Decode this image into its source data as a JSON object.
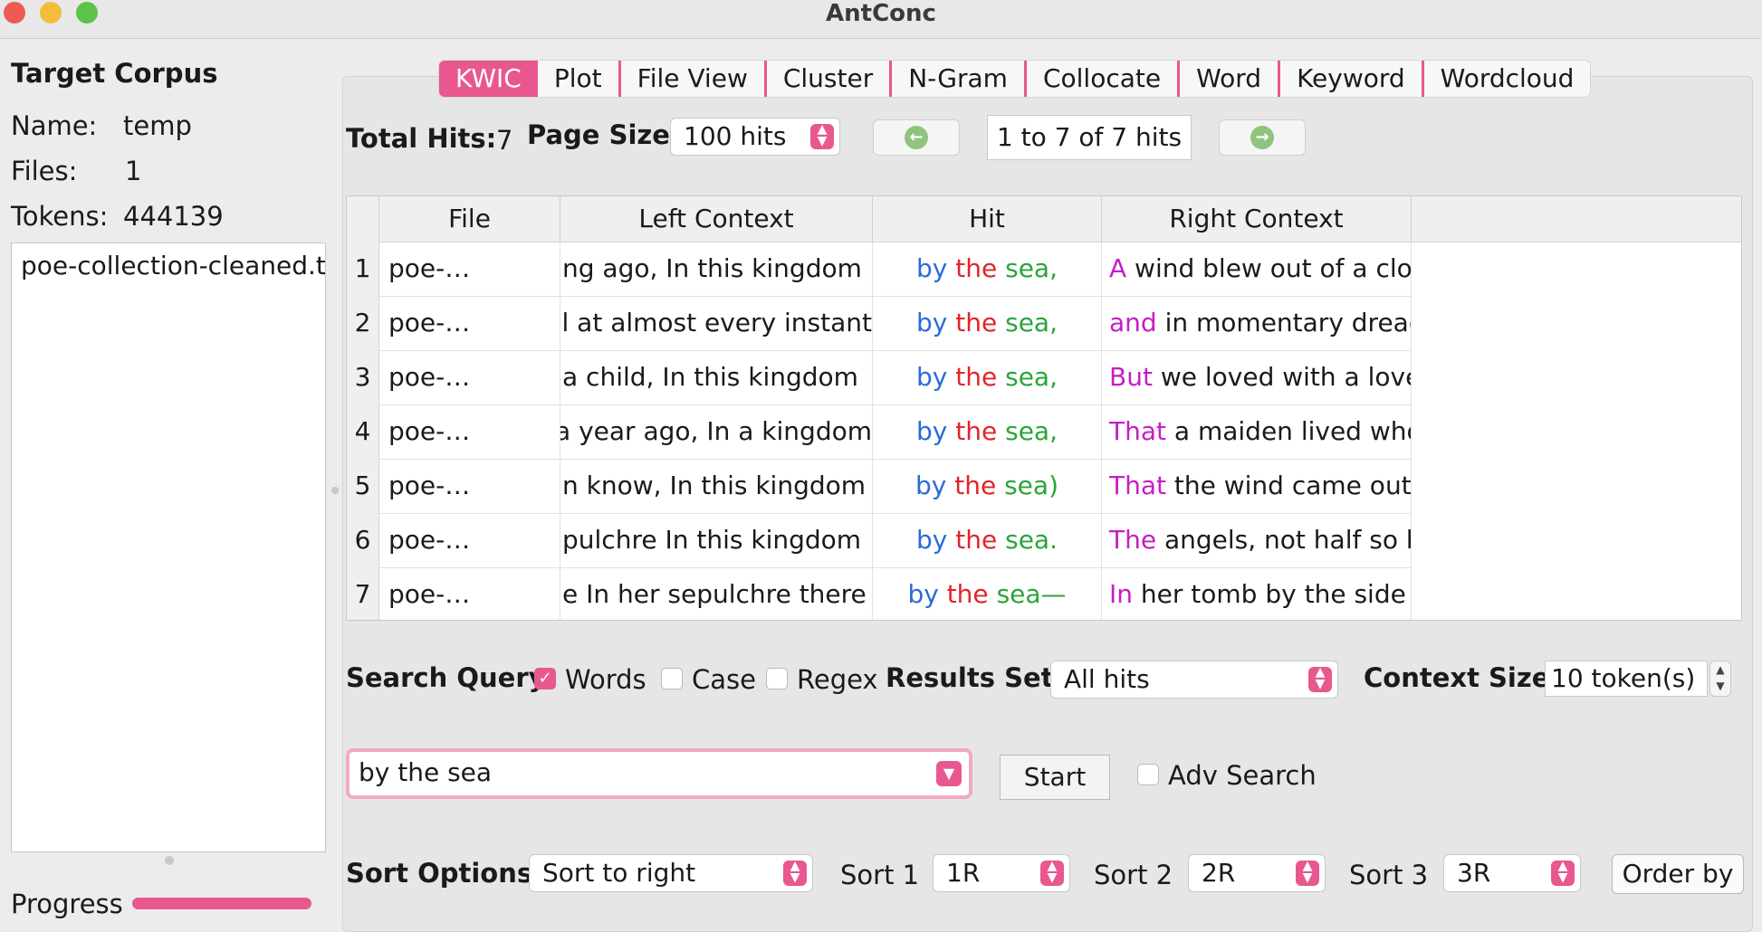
{
  "window": {
    "title": "AntConc"
  },
  "left_panel": {
    "heading": "Target Corpus",
    "name_label": "Name:",
    "name_value": "temp",
    "files_label": "Files:",
    "files_value": "1",
    "tokens_label": "Tokens:",
    "tokens_value": "444139",
    "files": [
      "poe-collection-cleaned.t"
    ],
    "progress_label": "Progress",
    "progress_fraction": 1.0
  },
  "tabs": [
    "KWIC",
    "Plot",
    "File View",
    "Cluster",
    "N-Gram",
    "Collocate",
    "Word",
    "Keyword",
    "Wordcloud"
  ],
  "active_tab": "KWIC",
  "toolbar": {
    "total_hits_label": "Total Hits:",
    "total_hits_value": "7",
    "page_size_label": "Page Size",
    "page_size_value": "100 hits",
    "range_text": "1 to 7 of 7 hits"
  },
  "table": {
    "headers": [
      "File",
      "Left Context",
      "Hit",
      "Right Context"
    ],
    "rows": [
      {
        "n": "1",
        "file": "poe-…",
        "left": "ng ago, In this kingdom",
        "hit": [
          "by",
          "the",
          "sea,"
        ],
        "rfirst": "A",
        "rrest": " wind blew out of a cloud"
      },
      {
        "n": "2",
        "file": "poe-…",
        "left": "l at almost every instant",
        "hit": [
          "by",
          "the",
          "sea,"
        ],
        "rfirst": "and",
        "rrest": " in momentary dread"
      },
      {
        "n": "3",
        "file": "poe-…",
        "left": "a child, In this kingdom",
        "hit": [
          "by",
          "the",
          "sea,"
        ],
        "rfirst": "But",
        "rrest": " we loved with a love"
      },
      {
        "n": "4",
        "file": "poe-…",
        "left": "a year ago, In a kingdom",
        "hit": [
          "by",
          "the",
          "sea,"
        ],
        "rfirst": "That",
        "rrest": " a maiden lived who"
      },
      {
        "n": "5",
        "file": "poe-…",
        "left": "n know, In this kingdom",
        "hit": [
          "by",
          "the",
          "sea)"
        ],
        "rfirst": "That",
        "rrest": " the wind came out of"
      },
      {
        "n": "6",
        "file": "poe-…",
        "left": "pulchre In this kingdom",
        "hit": [
          "by",
          "the",
          "sea."
        ],
        "rfirst": "The",
        "rrest": " angels, not half so happy"
      },
      {
        "n": "7",
        "file": "poe-…",
        "left": "e In her sepulchre there",
        "hit": [
          "by",
          "the",
          "sea—"
        ],
        "rfirst": "In",
        "rrest": " her tomb by the side of"
      }
    ]
  },
  "search": {
    "query_label": "Search Query",
    "words_label": "Words",
    "words_checked": true,
    "case_label": "Case",
    "case_checked": false,
    "regex_label": "Regex",
    "regex_checked": false,
    "results_set_label": "Results Set",
    "results_set_value": "All hits",
    "context_size_label": "Context Size",
    "context_size_value": "10 token(s)",
    "query_value": "by the sea",
    "start_label": "Start",
    "adv_search_label": "Adv Search",
    "adv_search_checked": false
  },
  "sort": {
    "label": "Sort Options",
    "mode_value": "Sort to right",
    "sort1_label": "Sort 1",
    "sort1_value": "1R",
    "sort2_label": "Sort 2",
    "sort2_value": "2R",
    "sort3_label": "Sort 3",
    "sort3_value": "3R",
    "order_label": "Order by"
  },
  "colors": {
    "accent": "#e8588f",
    "hit_by": "#2b6bd8",
    "hit_the": "#e0252b",
    "hit_sea": "#2aa53a",
    "right_first": "#c41fc4"
  }
}
